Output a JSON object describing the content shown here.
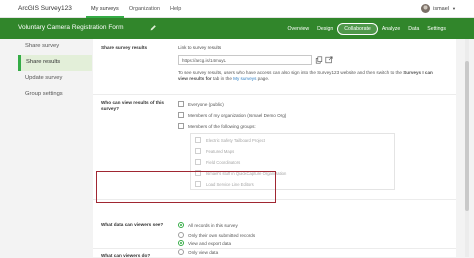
{
  "topbar": {
    "brand": "ArcGIS Survey123",
    "links": [
      "My surveys",
      "Organization",
      "Help"
    ],
    "user": "ismael"
  },
  "header": {
    "survey_title": "Voluntary Camera Registration Form",
    "nav": [
      "Overview",
      "Design",
      "Collaborate",
      "Analyze",
      "Data",
      "Settings"
    ],
    "active_nav": "Collaborate"
  },
  "sidebar": {
    "items": [
      "Share survey",
      "Share results",
      "Update survey",
      "Group settings"
    ],
    "active": "Share results"
  },
  "share_results": {
    "label": "Share survey results",
    "link_label": "Link to survey results",
    "link_value": "https://arcg.is/14muyL",
    "note_pre": "To see survey results, users who have access can also sign into the Survey123 website and then switch to the ",
    "note_bold": "Surveys I can view results for",
    "note_mid": " tab in the ",
    "note_link": "My surveys",
    "note_post": " page."
  },
  "who_can_view": {
    "label": "Who can view results of this survey?",
    "options": [
      "Everyone (public)",
      "Members of my organization (Ismael Demo Org)",
      "Members of the following groups:"
    ],
    "groups": [
      "Electric Safety Tailboard Project",
      "Featured Maps",
      "Field Coordinators",
      "Ismael's stuff in QuickCapture Organization",
      "Load Service Line Editors"
    ]
  },
  "what_data": {
    "label": "What data can viewers see?",
    "options": [
      "All records in this survey",
      "Only their own submitted records"
    ],
    "selected": "All records in this survey"
  },
  "what_do": {
    "label": "What can viewers do?",
    "options": [
      "View and export data",
      "Only view data"
    ],
    "selected": "View and export data"
  },
  "colors": {
    "brand_green": "#31862b",
    "accent_green": "#35ac46",
    "highlight_red": "#a02732",
    "link_blue": "#2d7ec3"
  }
}
